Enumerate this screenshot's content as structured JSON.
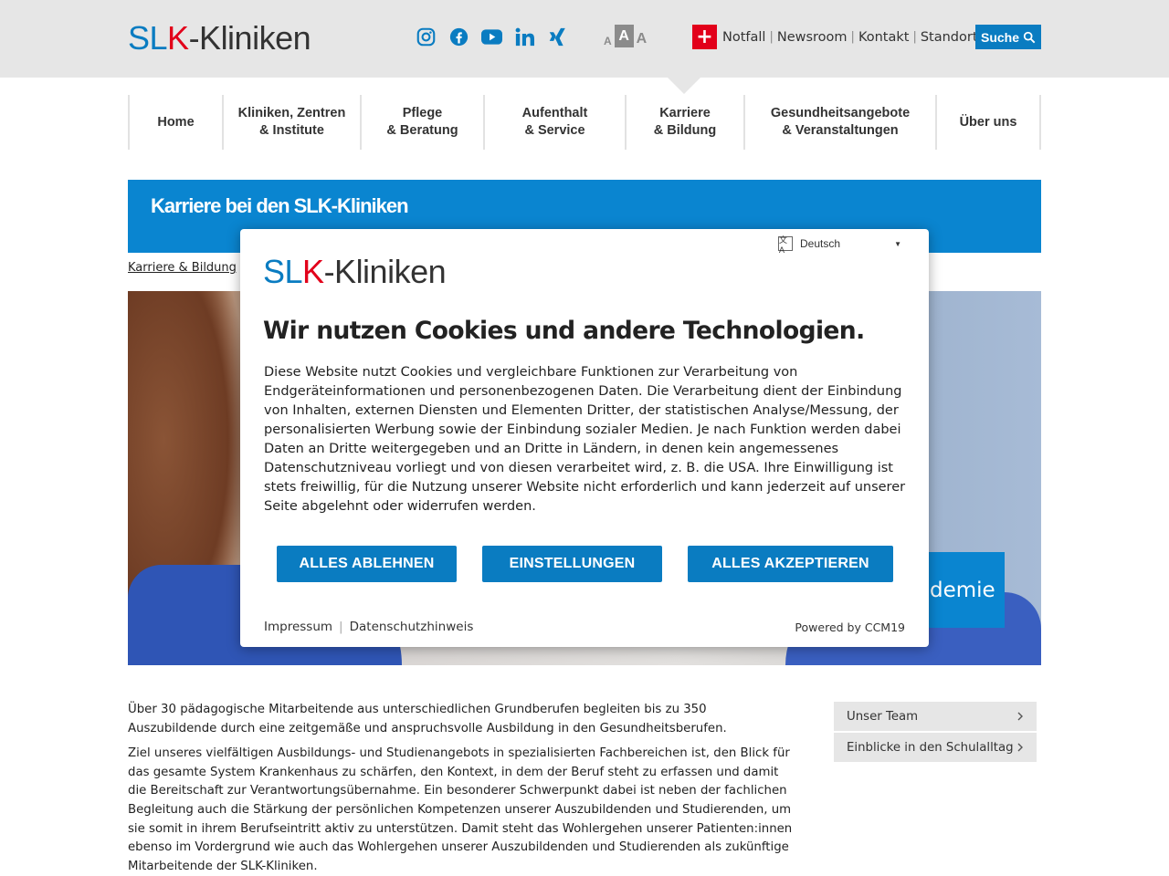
{
  "header": {
    "logo_slk": "SL",
    "logo_k": "K",
    "logo_rest": "-Kliniken",
    "social_icons": [
      "instagram-icon",
      "facebook-icon",
      "youtube-icon",
      "linkedin-icon",
      "xing-icon"
    ],
    "font_size_labels": [
      "A",
      "A",
      "A"
    ],
    "links": [
      "Notfall",
      "Newsroom",
      "Kontakt",
      "Standorte"
    ],
    "link_separator": "|",
    "search_label": "Suche",
    "accent": "#0a7cc1",
    "emergency_color": "#e2001a"
  },
  "mainnav": {
    "items": [
      "Home",
      "Kliniken, Zentren\n& Institute",
      "Pflege\n& Beratung",
      "Aufenthalt\n& Service",
      "Karriere\n& Bildung",
      "Gesundheitsangebote\n& Veranstaltungen",
      "Über uns"
    ],
    "active": "Karriere\n& Bildung"
  },
  "banner": {
    "title": "Karriere bei den SLK-Kliniken",
    "color": "#0a85d0"
  },
  "breadcrumb": "Karriere & Bildung",
  "hero": {
    "label_fragment": "demie"
  },
  "content": {
    "paragraphs": [
      "Über 30 pädagogische Mitarbeitende aus unterschiedlichen Grundberufen begleiten bis zu 350 Auszubildende durch eine zeitgemäße und anspruchsvolle Ausbildung in den Gesundheitsberufen.",
      "Ziel unseres vielfältigen Ausbildungs- und Studienangebots in spezialisierten Fachbereichen ist, den Blick für das gesamte System Krankenhaus zu schärfen, den Kontext, in dem der Beruf steht zu erfassen und damit die Bereitschaft zur Verantwortungsübernahme. Ein besonderer Schwerpunkt dabei ist neben der fachlichen Begleitung auch die Stärkung der persönlichen Kompetenzen unserer Auszubildenden und Studierenden, um sie somit in ihrem Berufseintritt aktiv zu unterstützen. Damit steht das Wohlergehen unserer Patienten:innen ebenso im Vordergrund wie auch das Wohlergehen unserer Auszubildenden und Studierenden als zukünftige Mitarbeitende der SLK-Kliniken."
    ]
  },
  "sidebar": {
    "items": [
      "Unser Team",
      "Einblicke in den Schulalltag"
    ]
  },
  "cookie_modal": {
    "language": "Deutsch",
    "title": "Wir nutzen Cookies und andere Technologien.",
    "text": "Diese Website nutzt Cookies und vergleichbare Funktionen zur Verarbeitung von Endgeräteinformationen und personenbezogenen Daten. Die Verarbeitung dient der Einbindung von Inhalten, externen Diensten und Elementen Dritter, der statistischen Analyse/Messung, der personalisierten Werbung sowie der Einbindung sozialer Medien. Je nach Funktion werden dabei Daten an Dritte weitergegeben und an Dritte in Ländern, in denen kein angemessenes Datenschutzniveau vorliegt und von diesen verarbeitet wird, z. B. die USA. Ihre Einwilligung ist stets freiwillig, für die Nutzung unserer Website nicht erforderlich und kann jederzeit auf unserer Seite abgelehnt oder widerrufen werden.",
    "buttons": {
      "reject": "ALLES ABLEHNEN",
      "settings": "EINSTELLUNGEN",
      "accept": "ALLES AKZEPTIEREN"
    },
    "footer_links": [
      "Impressum",
      "Datenschutzhinweis"
    ],
    "powered_by": "Powered by CCM19"
  }
}
